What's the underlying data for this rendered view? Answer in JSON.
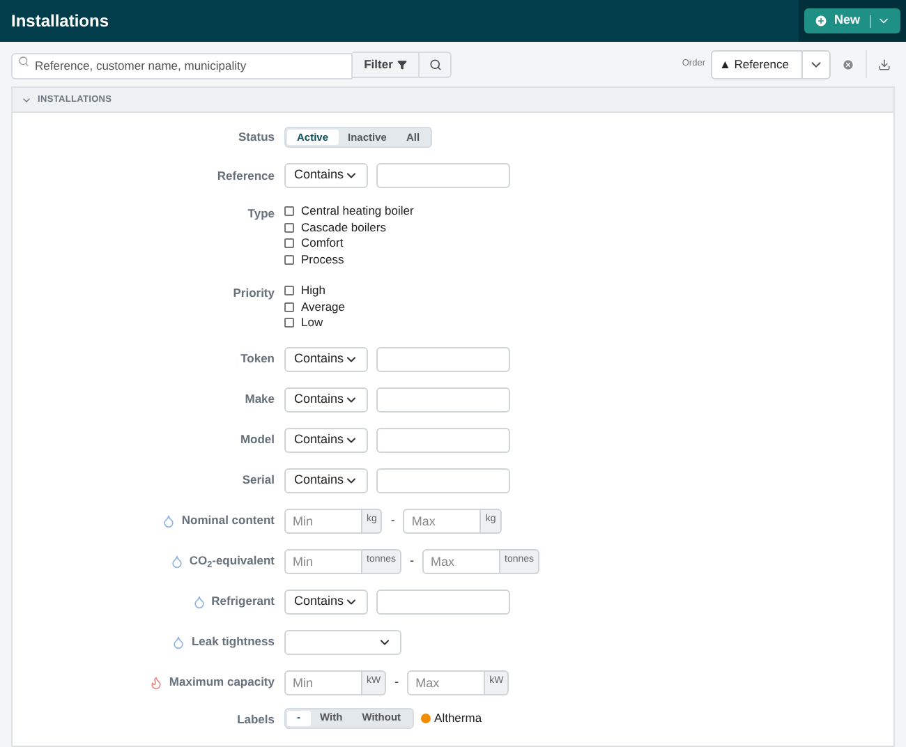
{
  "header": {
    "title": "Installations",
    "new_button": "New"
  },
  "toolbar": {
    "search_placeholder": "Reference, customer name, municipality",
    "filter_button": "Filter",
    "order_label": "Order",
    "order_value": "▲ Reference"
  },
  "panel": {
    "title": "INSTALLATIONS",
    "expanded": true
  },
  "fields": [
    {
      "kind": "segmented",
      "label": "Status",
      "options": [
        {
          "label": "Active",
          "selected": true
        },
        {
          "label": "Inactive",
          "selected": false
        },
        {
          "label": "All",
          "selected": false
        }
      ]
    },
    {
      "kind": "text_filter",
      "label": "Reference",
      "operator": "Contains"
    },
    {
      "kind": "checkboxes",
      "label": "Type",
      "options": [
        {
          "label": "Central heating boiler",
          "checked": false
        },
        {
          "label": "Cascade boilers",
          "checked": false
        },
        {
          "label": "Comfort",
          "checked": false
        },
        {
          "label": "Process",
          "checked": false
        }
      ]
    },
    {
      "kind": "checkboxes",
      "label": "Priority",
      "options": [
        {
          "label": "High",
          "checked": false
        },
        {
          "label": "Average",
          "checked": false
        },
        {
          "label": "Low",
          "checked": false
        }
      ]
    },
    {
      "kind": "text_filter",
      "label": "Token",
      "operator": "Contains"
    },
    {
      "kind": "text_filter",
      "label": "Make",
      "operator": "Contains"
    },
    {
      "kind": "text_filter",
      "label": "Model",
      "operator": "Contains"
    },
    {
      "kind": "text_filter",
      "label": "Serial",
      "operator": "Contains"
    },
    {
      "kind": "range",
      "label": "Nominal content",
      "min_placeholder": "Min",
      "min_unit": "kg",
      "separator": "-",
      "max_placeholder": "Max",
      "max_unit": "kg"
    },
    {
      "kind": "range",
      "label": "CO$_{2}$-equivalent",
      "min_placeholder": "Min",
      "min_unit": "tonnes",
      "separator": "-",
      "max_placeholder": "Max",
      "max_unit": "tonnes"
    },
    {
      "kind": "text_filter",
      "label": "Refrigerant",
      "operator": "Contains"
    },
    {
      "kind": "select",
      "label": "Leak tightness"
    },
    {
      "kind": "range",
      "label": "Maximum capacity",
      "min_placeholder": "Min",
      "min_unit": "kW",
      "separator": "-",
      "max_placeholder": "Max",
      "max_unit": "kW"
    },
    {
      "kind": "labels",
      "label": "Labels",
      "options": [
        {
          "label": "-",
          "selected": true
        },
        {
          "label": "With",
          "selected": false
        },
        {
          "label": "Without",
          "selected": false
        }
      ],
      "tags": [
        {
          "label": "Altherma",
          "color": "#f28c00"
        }
      ]
    }
  ]
}
